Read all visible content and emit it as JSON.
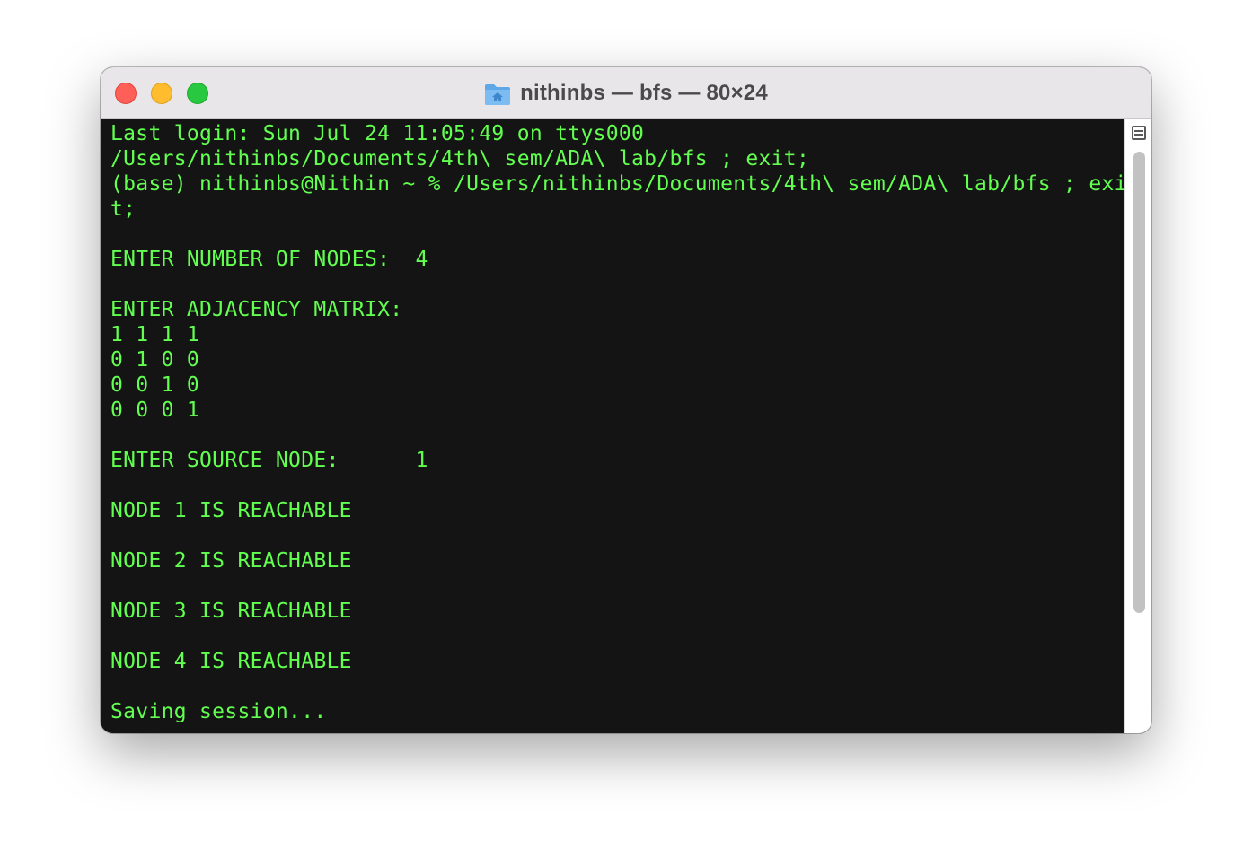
{
  "window": {
    "title": "nithinbs — bfs — 80×24",
    "title_icon": "home-folder-icon",
    "accent_text_color": "#62ff50",
    "background_color": "#141414"
  },
  "traffic_lights": {
    "close_color": "#fe5f57",
    "minimize_color": "#febc2e",
    "zoom_color": "#28c840"
  },
  "terminal": {
    "lines": [
      "Last login: Sun Jul 24 11:05:49 on ttys000",
      "/Users/nithinbs/Documents/4th\\ sem/ADA\\ lab/bfs ; exit;",
      "(base) nithinbs@Nithin ~ % /Users/nithinbs/Documents/4th\\ sem/ADA\\ lab/bfs ; exi",
      "t;",
      "",
      "ENTER NUMBER OF NODES:  4",
      "",
      "ENTER ADJACENCY MATRIX:",
      "1 1 1 1",
      "0 1 0 0",
      "0 0 1 0",
      "0 0 0 1",
      "",
      "ENTER SOURCE NODE:      1",
      "",
      "NODE 1 IS REACHABLE",
      "",
      "NODE 2 IS REACHABLE",
      "",
      "NODE 3 IS REACHABLE",
      "",
      "NODE 4 IS REACHABLE",
      "",
      "Saving session..."
    ]
  },
  "scrollbar": {
    "split_icon": "split-pane-icon"
  }
}
